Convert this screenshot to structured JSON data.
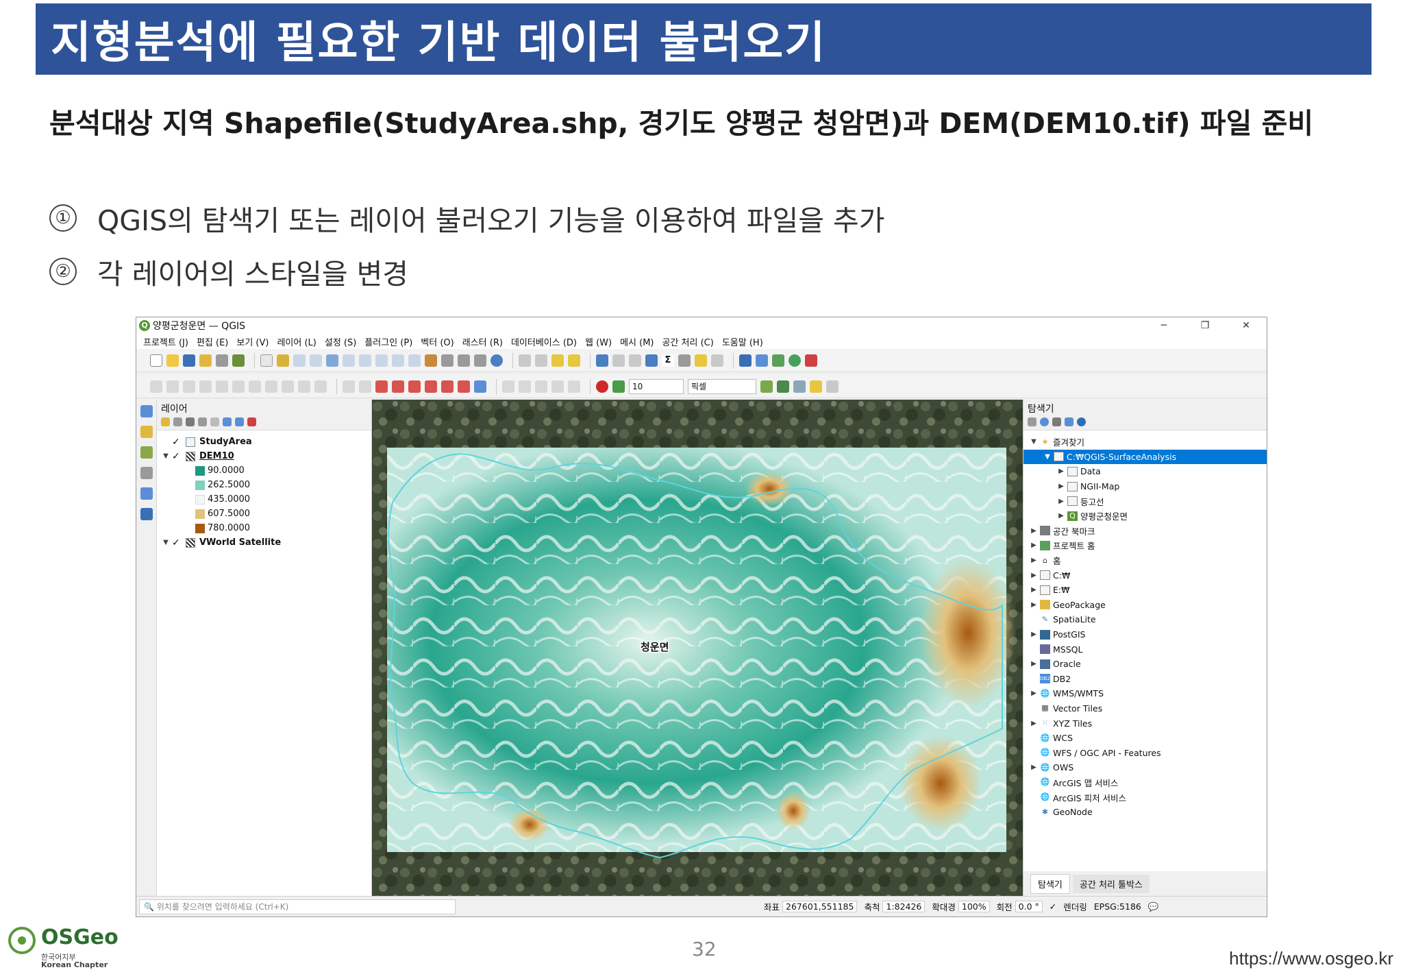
{
  "slide": {
    "title": "지형분석에 필요한 기반 데이터 불러오기",
    "subtitle": "분석대상 지역 Shapefile(StudyArea.shp, 경기도 양평군 청암면)과 DEM(DEM10.tif) 파일 준비",
    "steps": [
      {
        "num": "①",
        "text": "QGIS의 탐색기 또는 레이어 불러오기 기능을 이용하여 파일을 추가"
      },
      {
        "num": "②",
        "text": "각 레이어의 스타일을 변경"
      }
    ],
    "page_number": "32",
    "url": "https://www.osgeo.kr"
  },
  "logo": {
    "name": "OSGeo",
    "sub1": "한국어지부",
    "sub2": "Korean Chapter"
  },
  "qgis": {
    "window_title": "양평군청운면 — QGIS",
    "window_buttons": [
      "─",
      "❐",
      "✕"
    ],
    "menu": [
      "프로젝트 (J)",
      "편집 (E)",
      "보기 (V)",
      "레이어 (L)",
      "설정 (S)",
      "플러그인 (P)",
      "벡터 (O)",
      "래스터 (R)",
      "데이터베이스 (D)",
      "웹 (W)",
      "메시 (M)",
      "공간 처리 (C)",
      "도움말 (H)"
    ],
    "toolbar": {
      "snap_tolerance": "10",
      "snap_units": "픽셀"
    },
    "layers_panel": {
      "title": "레이어",
      "layers": [
        {
          "name": "StudyArea",
          "checked": "✓"
        },
        {
          "name": "DEM10",
          "checked": "✓",
          "legend": [
            {
              "label": "90.0000",
              "color": "#1a9a83"
            },
            {
              "label": "262.5000",
              "color": "#7fd0bd"
            },
            {
              "label": "435.0000",
              "color": "#f3f6f2"
            },
            {
              "label": "607.5000",
              "color": "#e2c17c"
            },
            {
              "label": "780.0000",
              "color": "#a8590f"
            }
          ]
        },
        {
          "name": "VWorld Satellite",
          "checked": "✓"
        }
      ]
    },
    "map": {
      "label": "청운면"
    },
    "browser_panel": {
      "title": "탐색기",
      "items": [
        {
          "label": "즐겨찾기",
          "icon": "star-icon",
          "indent": 0,
          "arrow": "▼"
        },
        {
          "label": "C:₩QGIS-SurfaceAnalysis",
          "icon": "folder-icon",
          "indent": 1,
          "arrow": "▼",
          "selected": true
        },
        {
          "label": "Data",
          "icon": "folder-icon",
          "indent": 2,
          "arrow": "▶"
        },
        {
          "label": "NGII-Map",
          "icon": "folder-icon",
          "indent": 2,
          "arrow": "▶"
        },
        {
          "label": "등고선",
          "icon": "folder-icon",
          "indent": 2,
          "arrow": "▶"
        },
        {
          "label": "양평군청운면",
          "icon": "qgis-project-icon",
          "indent": 2,
          "arrow": "▶"
        },
        {
          "label": "공간 북마크",
          "icon": "bookmark-icon",
          "indent": 0,
          "arrow": "▶"
        },
        {
          "label": "프로젝트 홈",
          "icon": "project-home-icon",
          "indent": 0,
          "arrow": "▶"
        },
        {
          "label": "홈",
          "icon": "home-icon",
          "indent": 0,
          "arrow": "▶"
        },
        {
          "label": "C:₩",
          "icon": "drive-icon",
          "indent": 0,
          "arrow": "▶"
        },
        {
          "label": "E:₩",
          "icon": "drive-icon",
          "indent": 0,
          "arrow": "▶"
        },
        {
          "label": "GeoPackage",
          "icon": "geopackage-icon",
          "indent": 0,
          "arrow": "▶"
        },
        {
          "label": "SpatiaLite",
          "icon": "spatialite-icon",
          "indent": 0,
          "arrow": ""
        },
        {
          "label": "PostGIS",
          "icon": "postgis-icon",
          "indent": 0,
          "arrow": "▶"
        },
        {
          "label": "MSSQL",
          "icon": "mssql-icon",
          "indent": 0,
          "arrow": ""
        },
        {
          "label": "Oracle",
          "icon": "oracle-icon",
          "indent": 0,
          "arrow": "▶"
        },
        {
          "label": "DB2",
          "icon": "db2-icon",
          "indent": 0,
          "arrow": ""
        },
        {
          "label": "WMS/WMTS",
          "icon": "globe-icon",
          "indent": 0,
          "arrow": "▶"
        },
        {
          "label": "Vector Tiles",
          "icon": "grid-icon",
          "indent": 0,
          "arrow": ""
        },
        {
          "label": "XYZ Tiles",
          "icon": "tiles-icon",
          "indent": 0,
          "arrow": "▶"
        },
        {
          "label": "WCS",
          "icon": "globe-icon",
          "indent": 0,
          "arrow": ""
        },
        {
          "label": "WFS / OGC API - Features",
          "icon": "globe-icon",
          "indent": 0,
          "arrow": ""
        },
        {
          "label": "OWS",
          "icon": "globe-icon",
          "indent": 0,
          "arrow": "▶"
        },
        {
          "label": "ArcGIS 맵 서비스",
          "icon": "globe-icon",
          "indent": 0,
          "arrow": ""
        },
        {
          "label": "ArcGIS 피처 서비스",
          "icon": "globe-icon",
          "indent": 0,
          "arrow": ""
        },
        {
          "label": "GeoNode",
          "icon": "geonode-icon",
          "indent": 0,
          "arrow": ""
        }
      ],
      "tabs": [
        "탐색기",
        "공간 처리 툴박스"
      ]
    },
    "status": {
      "locator_placeholder": "🔍 위치를 찾으려면 입력하세요 (Ctrl+K)",
      "coord_label": "좌표",
      "coord_value": "267601,551185",
      "scale_label": "축척",
      "scale_value": "1:82426",
      "magnifier_label": "확대경",
      "magnifier_value": "100%",
      "rotation_label": "회전",
      "rotation_value": "0.0 °",
      "render_label": "렌더링",
      "crs": "EPSG:5186"
    }
  }
}
